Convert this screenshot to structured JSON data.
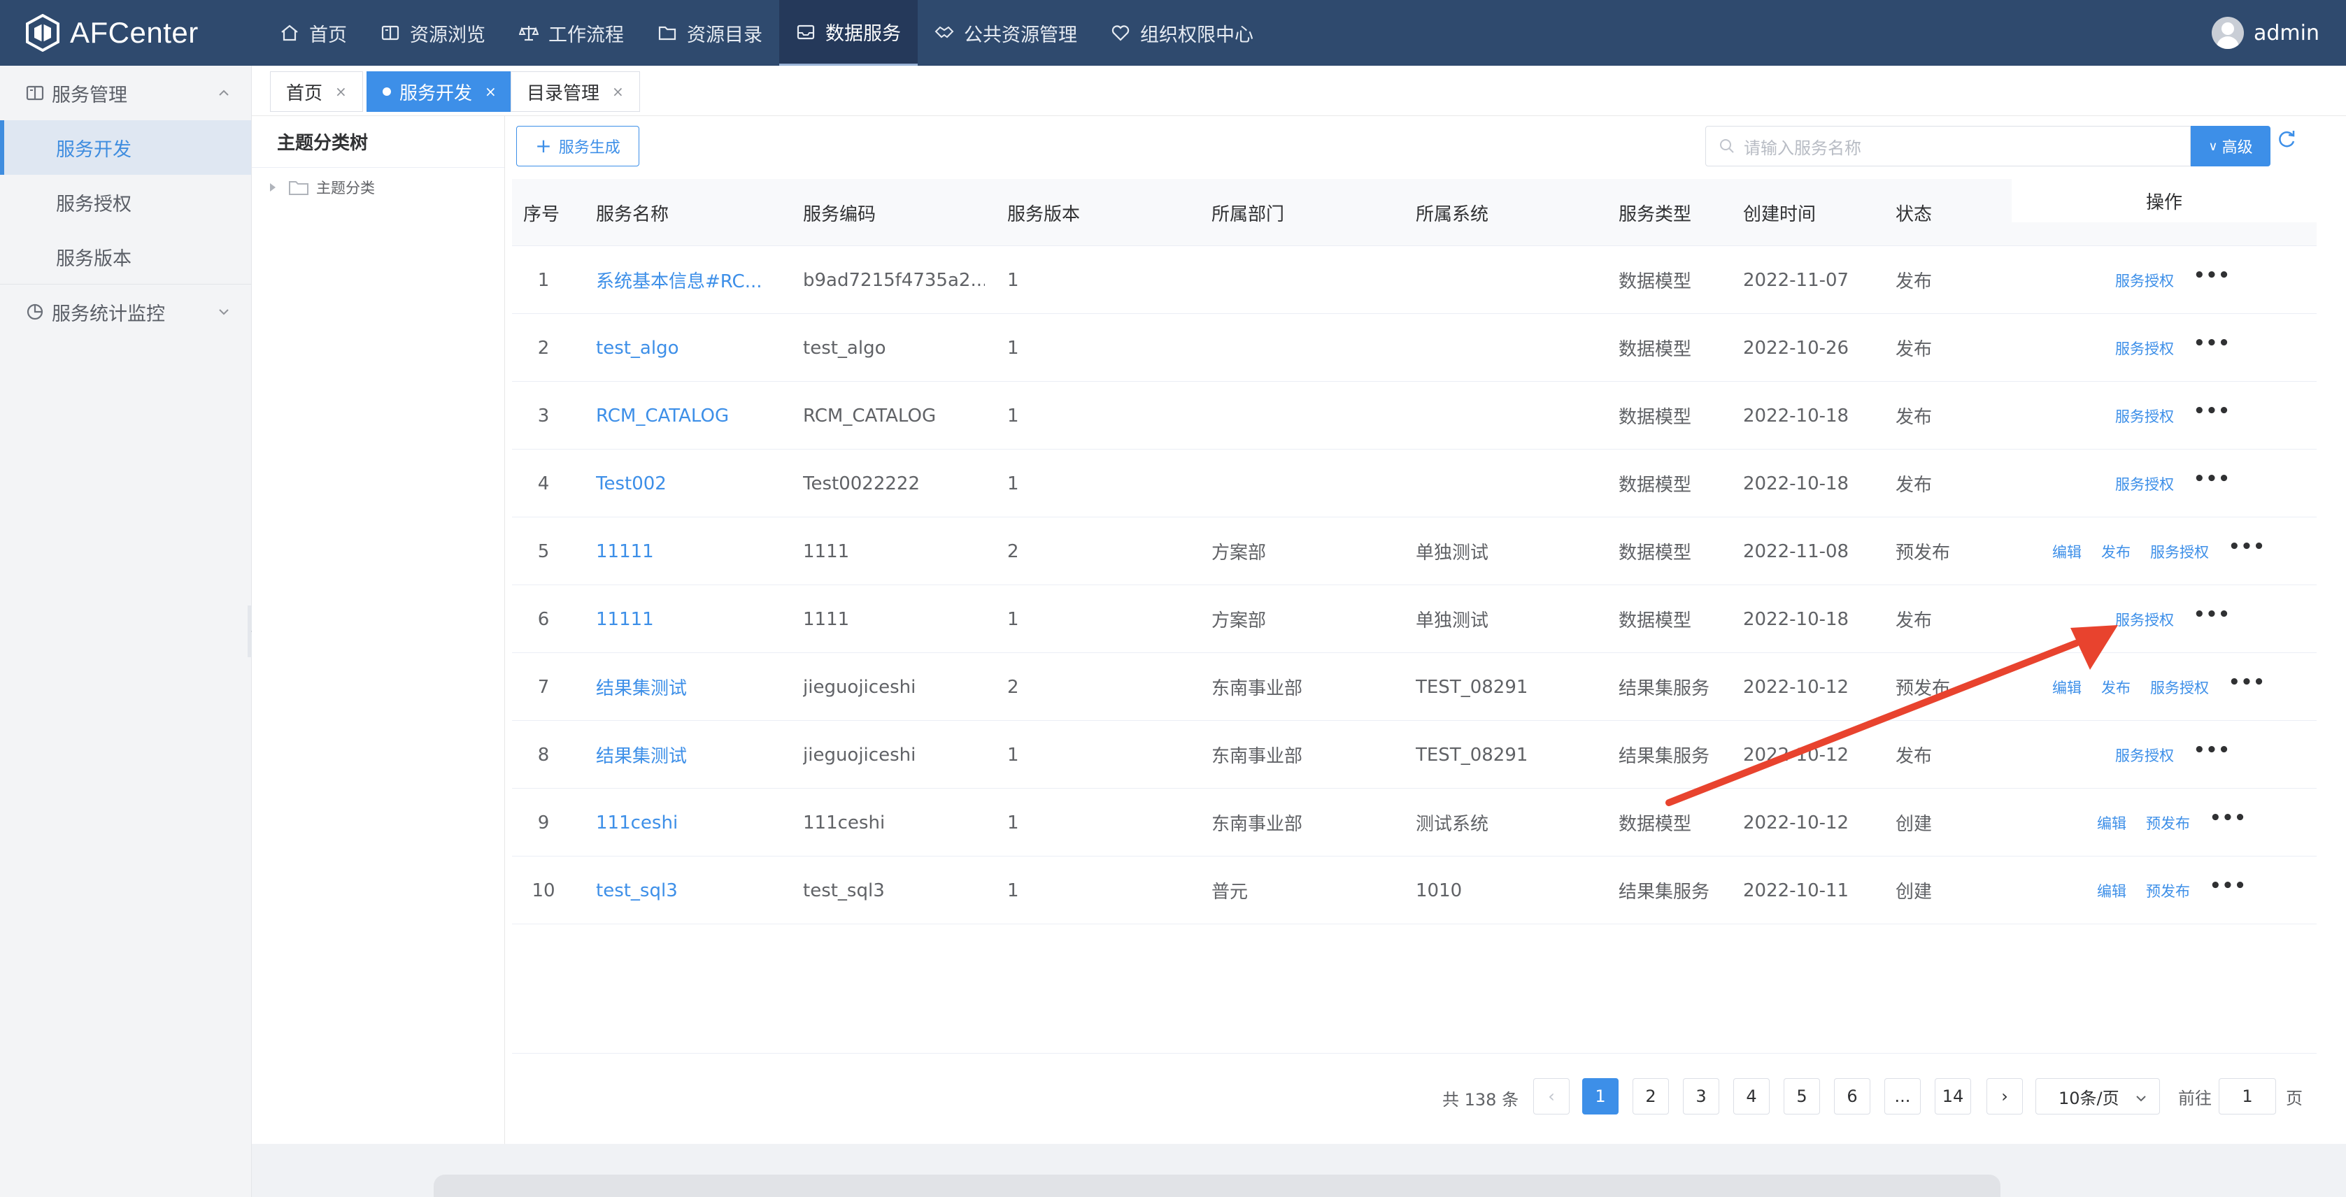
{
  "app": {
    "name": "AFCenter"
  },
  "topnav": [
    {
      "label": "首页",
      "icon": "home-icon"
    },
    {
      "label": "资源浏览",
      "icon": "book-icon"
    },
    {
      "label": "工作流程",
      "icon": "scale-icon"
    },
    {
      "label": "资源目录",
      "icon": "folder-icon"
    },
    {
      "label": "数据服务",
      "icon": "inbox-icon",
      "active": true
    },
    {
      "label": "公共资源管理",
      "icon": "handshake-icon"
    },
    {
      "label": "组织权限中心",
      "icon": "heart-icon"
    }
  ],
  "user": {
    "name": "admin"
  },
  "sidebar": {
    "groups": [
      {
        "label": "服务管理",
        "icon": "book-icon",
        "expanded": true,
        "items": [
          {
            "label": "服务开发",
            "active": true
          },
          {
            "label": "服务授权"
          },
          {
            "label": "服务版本"
          }
        ]
      },
      {
        "label": "服务统计监控",
        "icon": "pie-chart-icon",
        "expanded": false,
        "items": []
      }
    ]
  },
  "tabs": [
    {
      "label": "首页"
    },
    {
      "label": "服务开发",
      "active": true
    },
    {
      "label": "目录管理"
    }
  ],
  "tree": {
    "title": "主题分类树",
    "root": "主题分类"
  },
  "toolbar": {
    "generate_label": "服务生成",
    "search_placeholder": "请输入服务名称",
    "advanced_label": "高级"
  },
  "table": {
    "columns": [
      "序号",
      "服务名称",
      "服务编码",
      "服务版本",
      "所属部门",
      "所属系统",
      "服务类型",
      "创建时间",
      "状态"
    ],
    "ops_header": "操作",
    "rows": [
      {
        "idx": "1",
        "name": "系统基本信息#RC...",
        "code": "b9ad7215f4735a2...",
        "version": "1",
        "dept": "",
        "system": "",
        "type": "数据模型",
        "created": "2022-11-07",
        "status": "发布",
        "ops": [
          "服务授权"
        ]
      },
      {
        "idx": "2",
        "name": "test_algo",
        "code": "test_algo",
        "version": "1",
        "dept": "",
        "system": "",
        "type": "数据模型",
        "created": "2022-10-26",
        "status": "发布",
        "ops": [
          "服务授权"
        ]
      },
      {
        "idx": "3",
        "name": "RCM_CATALOG",
        "code": "RCM_CATALOG",
        "version": "1",
        "dept": "",
        "system": "",
        "type": "数据模型",
        "created": "2022-10-18",
        "status": "发布",
        "ops": [
          "服务授权"
        ]
      },
      {
        "idx": "4",
        "name": "Test002",
        "code": "Test0022222",
        "version": "1",
        "dept": "",
        "system": "",
        "type": "数据模型",
        "created": "2022-10-18",
        "status": "发布",
        "ops": [
          "服务授权"
        ]
      },
      {
        "idx": "5",
        "name": "11111",
        "code": "1111",
        "version": "2",
        "dept": "方案部",
        "system": "单独测试",
        "type": "数据模型",
        "created": "2022-11-08",
        "status": "预发布",
        "ops": [
          "编辑",
          "发布",
          "服务授权"
        ]
      },
      {
        "idx": "6",
        "name": "11111",
        "code": "1111",
        "version": "1",
        "dept": "方案部",
        "system": "单独测试",
        "type": "数据模型",
        "created": "2022-10-18",
        "status": "发布",
        "ops": [
          "服务授权"
        ]
      },
      {
        "idx": "7",
        "name": "结果集测试",
        "code": "jieguojiceshi",
        "version": "2",
        "dept": "东南事业部",
        "system": "TEST_08291",
        "type": "结果集服务",
        "created": "2022-10-12",
        "status": "预发布",
        "ops": [
          "编辑",
          "发布",
          "服务授权"
        ]
      },
      {
        "idx": "8",
        "name": "结果集测试",
        "code": "jieguojiceshi",
        "version": "1",
        "dept": "东南事业部",
        "system": "TEST_08291",
        "type": "结果集服务",
        "created": "2022-10-12",
        "status": "发布",
        "ops": [
          "服务授权"
        ]
      },
      {
        "idx": "9",
        "name": "111ceshi",
        "code": "111ceshi",
        "version": "1",
        "dept": "东南事业部",
        "system": "测试系统",
        "type": "数据模型",
        "created": "2022-10-12",
        "status": "创建",
        "ops": [
          "编辑",
          "预发布"
        ]
      },
      {
        "idx": "10",
        "name": "test_sql3",
        "code": "test_sql3",
        "version": "1",
        "dept": "普元",
        "system": "1010",
        "type": "结果集服务",
        "created": "2022-10-11",
        "status": "创建",
        "ops": [
          "编辑",
          "预发布"
        ]
      }
    ]
  },
  "pagination": {
    "total_text": "共 138 条",
    "pages": [
      "1",
      "2",
      "3",
      "4",
      "5",
      "6",
      "...",
      "14"
    ],
    "current": "1",
    "page_size": "10条/页",
    "goto_prefix": "前往",
    "goto_value": "1",
    "goto_suffix": "页"
  },
  "colors": {
    "topbar": "#2f4a6e",
    "primary": "#3d8fe8",
    "annotation_arrow": "#e8432e"
  }
}
